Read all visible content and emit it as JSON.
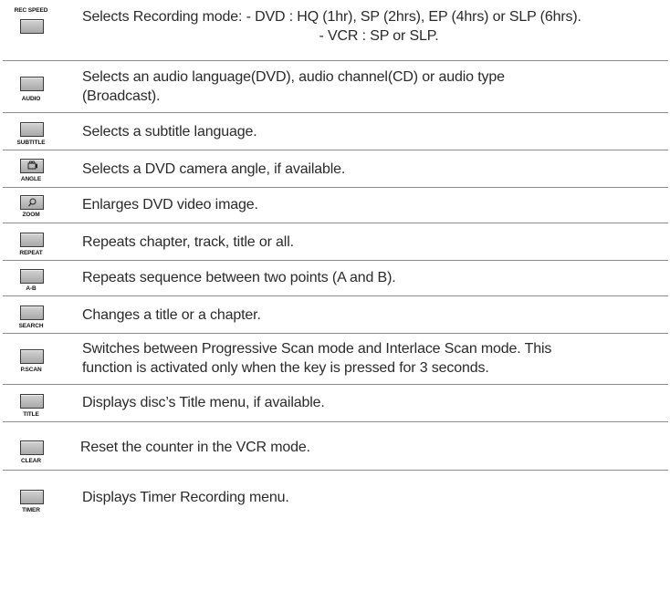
{
  "rows": [
    {
      "label": "REC SPEED",
      "icon": "rec-speed-button-icon",
      "lines": [
        "Selects Recording mode: - DVD : HQ (1hr), SP (2hrs), EP (4hrs) or SLP (6hrs).",
        "- VCR : SP or SLP."
      ]
    },
    {
      "label": "AUDIO",
      "icon": "audio-button-icon",
      "lines": [
        "Selects an audio language(DVD), audio channel(CD) or audio type",
        "(Broadcast)."
      ]
    },
    {
      "label": "SUBTITLE",
      "icon": "subtitle-button-icon",
      "lines": [
        "Selects a subtitle language."
      ]
    },
    {
      "label": "ANGLE",
      "icon": "camera-angle-icon",
      "lines": [
        "Selects a DVD camera angle, if available."
      ]
    },
    {
      "label": "ZOOM",
      "icon": "magnifier-icon",
      "lines": [
        "Enlarges DVD video image."
      ]
    },
    {
      "label": "REPEAT",
      "icon": "repeat-button-icon",
      "lines": [
        "Repeats chapter, track, title or all."
      ]
    },
    {
      "label": "A-B",
      "icon": "a-b-button-icon",
      "lines": [
        "Repeats sequence between two points (A and B)."
      ]
    },
    {
      "label": "SEARCH",
      "icon": "search-button-icon",
      "lines": [
        "Changes a title or a chapter."
      ]
    },
    {
      "label": "P.SCAN",
      "icon": "p-scan-button-icon",
      "lines": [
        "Switches between Progressive Scan mode and Interlace Scan mode. This",
        "function is activated only when the key is  pressed for 3 seconds."
      ]
    },
    {
      "label": "TITLE",
      "icon": "title-button-icon",
      "lines": [
        "Displays disc’s Title menu, if available."
      ]
    },
    {
      "label": "CLEAR",
      "icon": "clear-button-icon",
      "lines": [
        "Reset the counter in the VCR mode."
      ]
    },
    {
      "label": "TIMER",
      "icon": "timer-button-icon",
      "lines": [
        "Displays Timer Recording menu."
      ]
    }
  ]
}
